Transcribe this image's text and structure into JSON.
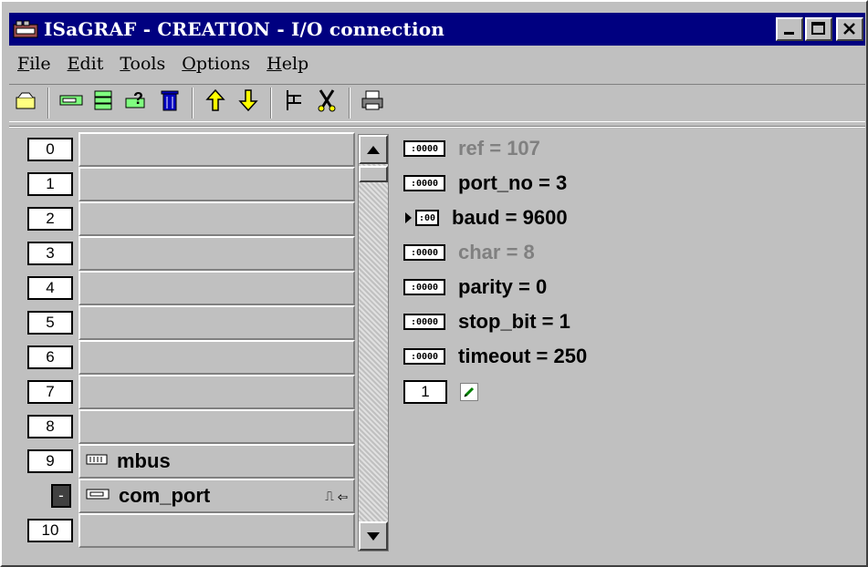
{
  "window": {
    "title": "ISaGRAF - CREATION - I/O connection",
    "buttons": [
      "_",
      "□",
      "X"
    ]
  },
  "menu": [
    {
      "label": "File",
      "u": "F",
      "rest": "ile"
    },
    {
      "label": "Edit",
      "u": "E",
      "rest": "dit"
    },
    {
      "label": "Tools",
      "u": "T",
      "rest": "ools"
    },
    {
      "label": "Options",
      "u": "O",
      "rest": "ptions"
    },
    {
      "label": "Help",
      "u": "H",
      "rest": "elp"
    }
  ],
  "toolbar": [
    {
      "icon": "open-board-icon",
      "glyph": "🖫"
    },
    {
      "sep": true
    },
    {
      "icon": "board-connect-icon",
      "glyph": "▭"
    },
    {
      "icon": "board-stack-icon",
      "glyph": "▤"
    },
    {
      "icon": "board-help-icon",
      "glyph": "?"
    },
    {
      "icon": "trash-icon",
      "glyph": "🗑"
    },
    {
      "sep": true
    },
    {
      "icon": "move-up-icon",
      "glyph": "⇧"
    },
    {
      "icon": "move-down-icon",
      "glyph": "⇩"
    },
    {
      "sep": true
    },
    {
      "icon": "tree-icon",
      "glyph": "⊢"
    },
    {
      "icon": "cut-icon",
      "glyph": "✂"
    },
    {
      "sep": true
    },
    {
      "icon": "print-icon",
      "glyph": "⎙"
    }
  ],
  "slots": [
    {
      "num": "0",
      "label": ""
    },
    {
      "num": "1",
      "label": ""
    },
    {
      "num": "2",
      "label": ""
    },
    {
      "num": "3",
      "label": ""
    },
    {
      "num": "4",
      "label": ""
    },
    {
      "num": "5",
      "label": ""
    },
    {
      "num": "6",
      "label": ""
    },
    {
      "num": "7",
      "label": ""
    },
    {
      "num": "8",
      "label": ""
    },
    {
      "num": "9",
      "label": "mbus",
      "icon": "board-icon"
    },
    {
      "num": "-",
      "label": "com_port",
      "icon": "port-icon",
      "dark": true,
      "extra": "⎍ ⇦"
    },
    {
      "num": "10",
      "label": ""
    }
  ],
  "params": [
    {
      "text": "ref = 107",
      "gray": true,
      "icon": ":0000"
    },
    {
      "text": "port_no = 3",
      "gray": false,
      "icon": ":0000"
    },
    {
      "text": "baud = 9600",
      "gray": false,
      "icon": ":00",
      "arrow": true
    },
    {
      "text": "char = 8",
      "gray": true,
      "icon": ":0000"
    },
    {
      "text": "parity = 0",
      "gray": false,
      "icon": ":0000"
    },
    {
      "text": "stop_bit = 1",
      "gray": false,
      "icon": ":0000"
    },
    {
      "text": "timeout = 250",
      "gray": false,
      "icon": ":0000"
    }
  ],
  "channel": {
    "num": "1"
  }
}
